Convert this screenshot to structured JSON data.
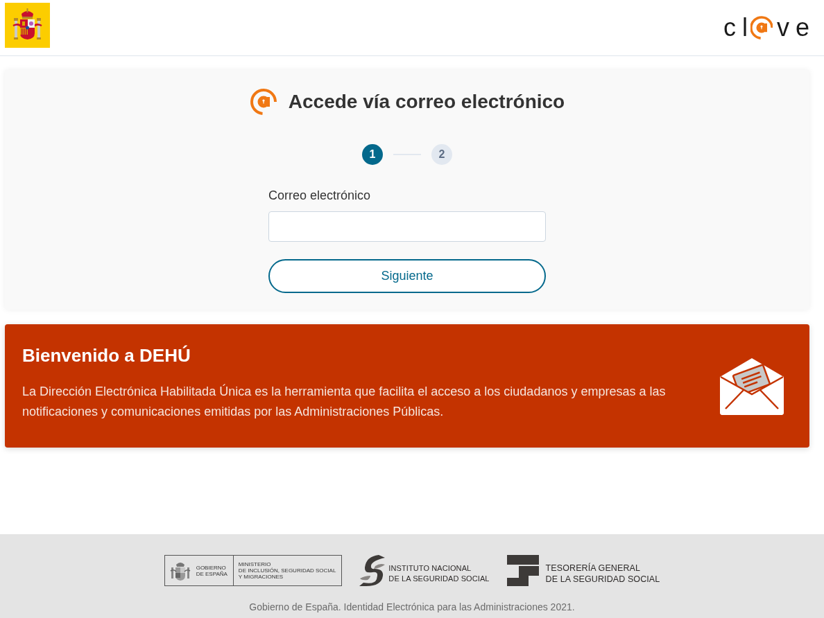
{
  "header": {
    "brand": {
      "text_start": "cl",
      "text_end": "ve"
    }
  },
  "login_card": {
    "title": "Accede vía correo electrónico",
    "steps": [
      {
        "label": "1",
        "selected": true
      },
      {
        "label": "2",
        "selected": false
      }
    ],
    "email_field": {
      "label": "Correo electrónico"
    },
    "next_button": "Siguiente"
  },
  "welcome_banner": {
    "title": "Bienvenido a DEHÚ",
    "text": "La Dirección Electrónica Habilitada Única es la herramienta que facilita el acceso a los ciudadanos y empresas a las notificaciones y comunicaciones emitidas por las Administraciones Públicas."
  },
  "footer": {
    "logos": [
      {
        "kind": "government",
        "lines": [
          "GOBIERNO",
          "DE ESPAÑA"
        ],
        "ministry_lines": [
          "MINISTERIO",
          "DE INCLUSIÓN, SEGURIDAD SOCIAL",
          "Y MIGRACIONES"
        ]
      },
      {
        "kind": "inss",
        "lines": [
          "INSTITUTO NACIONAL",
          "DE LA SEGURIDAD SOCIAL"
        ]
      },
      {
        "kind": "tgss",
        "lines": [
          "TESORERÍA GENERAL",
          "DE LA SEGURIDAD SOCIAL"
        ]
      }
    ],
    "copyright": "Gobierno de España. Identidad Electrónica para las Administraciones 2021."
  }
}
